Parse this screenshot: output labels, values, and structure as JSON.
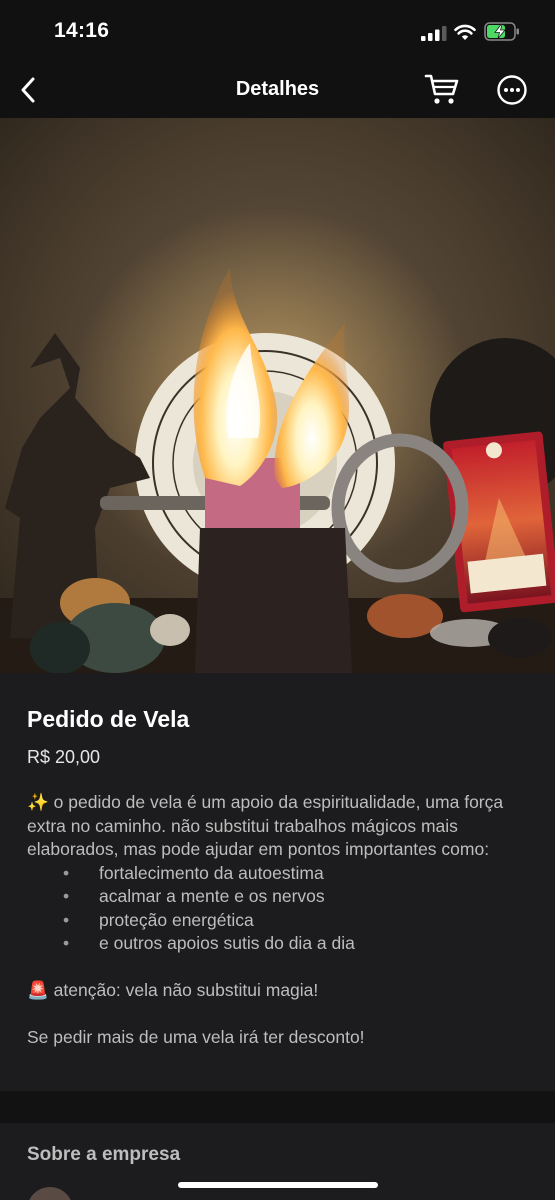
{
  "status_bar": {
    "time": "14:16"
  },
  "nav": {
    "title": "Detalhes",
    "icons": [
      "chevron-left-icon",
      "cart-icon",
      "more-options-icon"
    ]
  },
  "product": {
    "title": "Pedido de Vela",
    "price": "R$ 20,00",
    "description": {
      "intro_emoji": "✨",
      "intro": " o pedido de vela é um apoio da espiritualidade, uma força extra no caminho. não substitui trabalhos mágicos mais elaborados, mas pode ajudar em pontos importantes como:",
      "bullets": [
        "fortalecimento da autoestima",
        "acalmar a mente e os nervos",
        "proteção energética",
        "e outros apoios sutis do dia a dia"
      ],
      "warning_emoji": "🚨",
      "warning": " atenção: vela não substitui magia!",
      "discount": "Se pedir mais de uma vela irá ter desconto!"
    }
  },
  "company": {
    "label": "Sobre a empresa"
  },
  "colors": {
    "background": "#1c1c1e",
    "bar": "#111111",
    "text_primary": "#ffffff",
    "text_secondary": "#bdbdbd",
    "battery_charging": "#4cd964"
  }
}
